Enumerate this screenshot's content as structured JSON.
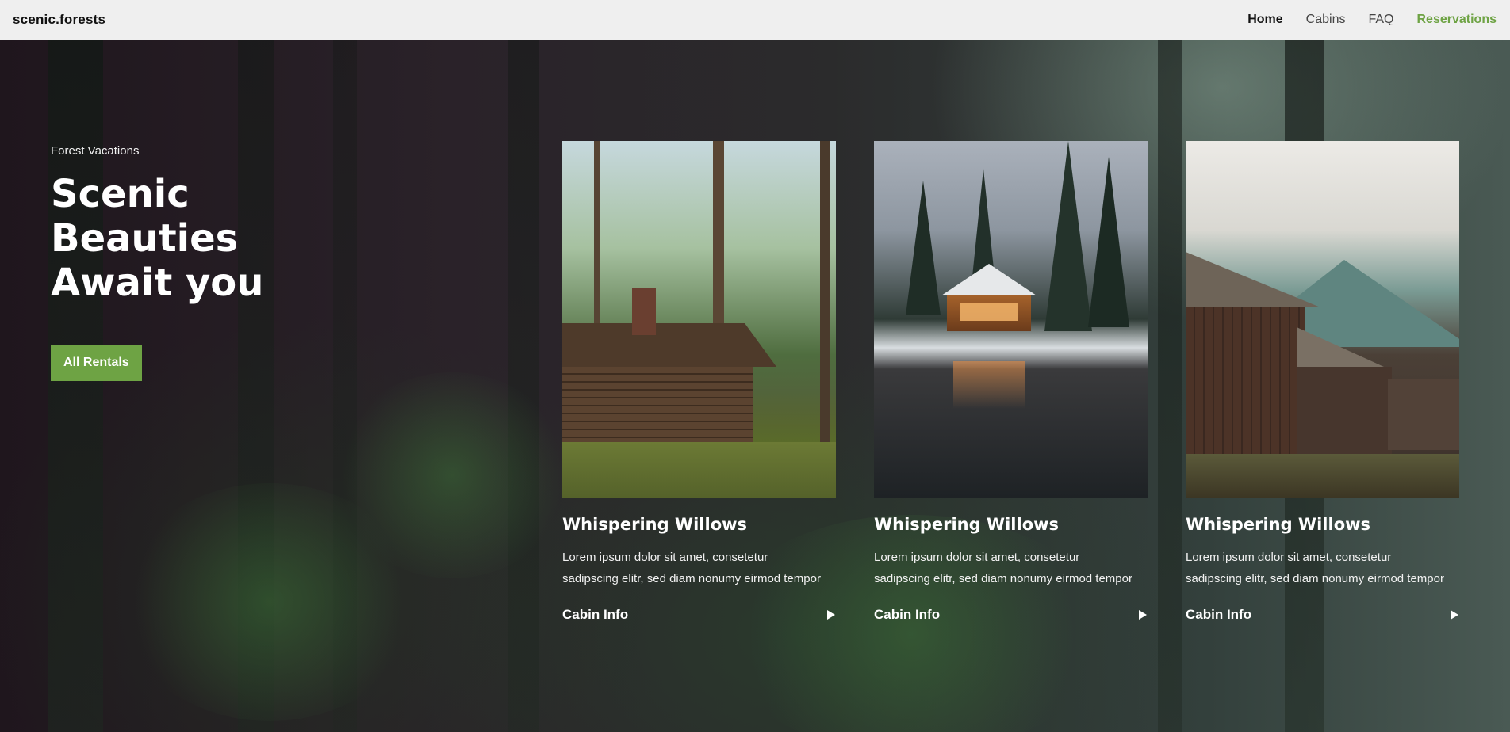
{
  "navbar": {
    "brand": "scenic.forests",
    "links": [
      {
        "label": "Home"
      },
      {
        "label": "Cabins"
      },
      {
        "label": "FAQ"
      },
      {
        "label": "Reservations"
      }
    ]
  },
  "hero": {
    "eyebrow": "Forest Vacations",
    "title": "Scenic\nBeauties\nAwait you",
    "cta_label": "All Rentals"
  },
  "cards": [
    {
      "title": "Whispering Willows",
      "description": "Lorem ipsum dolor sit amet, consetetur sadipscing elitr, sed diam nonumy eirmod tempor",
      "link_label": "Cabin Info"
    },
    {
      "title": "Whispering Willows",
      "description": "Lorem ipsum dolor sit amet, consetetur sadipscing elitr, sed diam nonumy eirmod tempor",
      "link_label": "Cabin Info"
    },
    {
      "title": "Whispering Willows",
      "description": "Lorem ipsum dolor sit amet, consetetur sadipscing elitr, sed diam nonumy eirmod tempor",
      "link_label": "Cabin Info"
    }
  ],
  "colors": {
    "accent": "#6ea344",
    "navbar_bg": "#efefef",
    "hero_bg": "#231820"
  },
  "icons": {
    "card_link_arrow": "play-arrow-icon"
  }
}
